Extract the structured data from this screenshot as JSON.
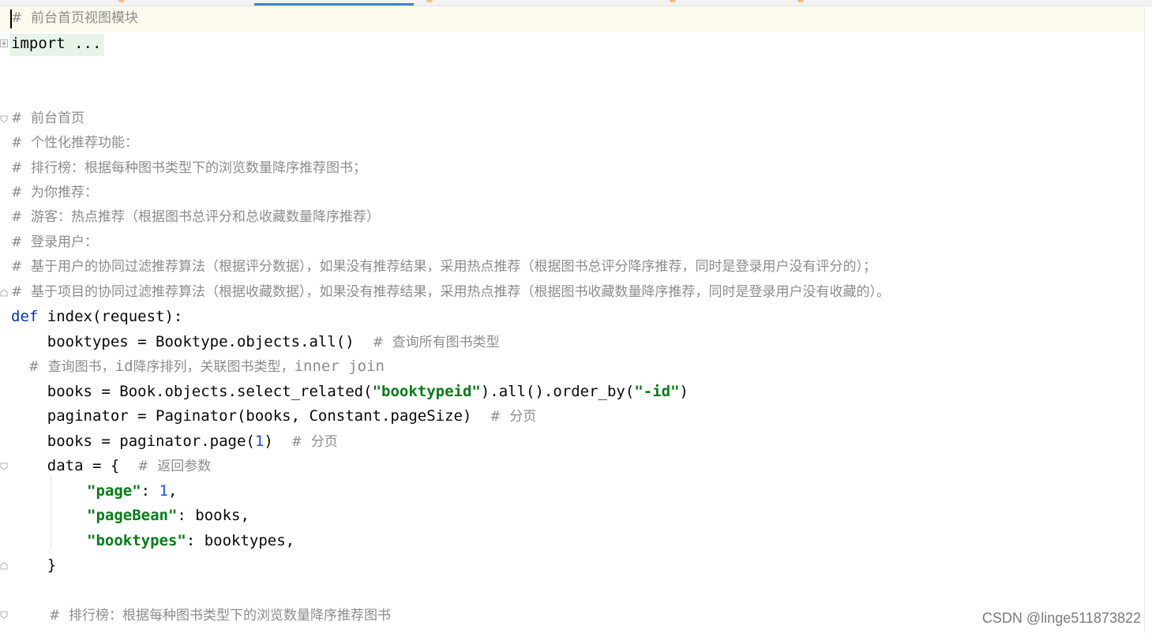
{
  "editor": {
    "lines": [
      {
        "kind": "comment",
        "text": "#  前台首页视图模块"
      },
      {
        "kind": "import",
        "text": "import ..."
      },
      {
        "kind": "comment",
        "text": "#  前台首页"
      },
      {
        "kind": "comment",
        "text": "#  个性化推荐功能："
      },
      {
        "kind": "comment",
        "text": "#  排行榜：根据每种图书类型下的浏览数量降序推荐图书；"
      },
      {
        "kind": "comment",
        "text": "#  为你推荐："
      },
      {
        "kind": "comment",
        "text": "#  游客：热点推荐（根据图书总评分和总收藏数量降序推荐）"
      },
      {
        "kind": "comment",
        "text": "#  登录用户："
      },
      {
        "kind": "comment",
        "text": "#  基于用户的协同过滤推荐算法（根据评分数据），如果没有推荐结果，采用热点推荐（根据图书总评分降序推荐，同时是登录用户没有评分的）；"
      },
      {
        "kind": "comment",
        "text": "#  基于项目的协同过滤推荐算法（根据收藏数据），如果没有推荐结果，采用热点推荐（根据图书收藏数量降序推荐，同时是登录用户没有收藏的）。"
      }
    ],
    "code": {
      "def_kw": "def",
      "def_rest": " index(request):",
      "l1_code": "    booktypes = Booktype.objects.all()  ",
      "l1_comment": "#  查询所有图书类型",
      "l2_comment_a": "    #  查询图书，",
      "l2_comment_b": "id",
      "l2_comment_c": "降序排列，关联图书类型，",
      "l2_comment_d": "inner join",
      "l3_a": "    books = Book.objects.select_related(",
      "l3_str1": "\"booktypeid\"",
      "l3_b": ").all().order_by(",
      "l3_str2": "\"-id\"",
      "l3_c": ")",
      "l4_code": "    paginator = Paginator(books, Constant.pageSize)  ",
      "l4_comment": "#  分页",
      "l5_a": "    books = paginator.page(",
      "l5_num": "1",
      "l5_b": ")  ",
      "l5_comment": "#  分页",
      "l6_code": "    data = {  ",
      "l6_comment": "#  返回参数",
      "l7_key": "\"page\"",
      "l7_a": ": ",
      "l7_num": "1",
      "l7_b": ",",
      "l8_key": "\"pageBean\"",
      "l8_rest": ": books,",
      "l9_key": "\"booktypes\"",
      "l9_rest": ": booktypes,",
      "l10": "    }",
      "l11_comment": "#  排行榜：根据每种图书类型下的浏览数量降序推荐图书"
    }
  },
  "watermark": "CSDN @linge511873822",
  "colors": {
    "keyword": "#0033b3",
    "string": "#067d17",
    "number": "#1750eb",
    "comment": "#8c8c8c"
  }
}
